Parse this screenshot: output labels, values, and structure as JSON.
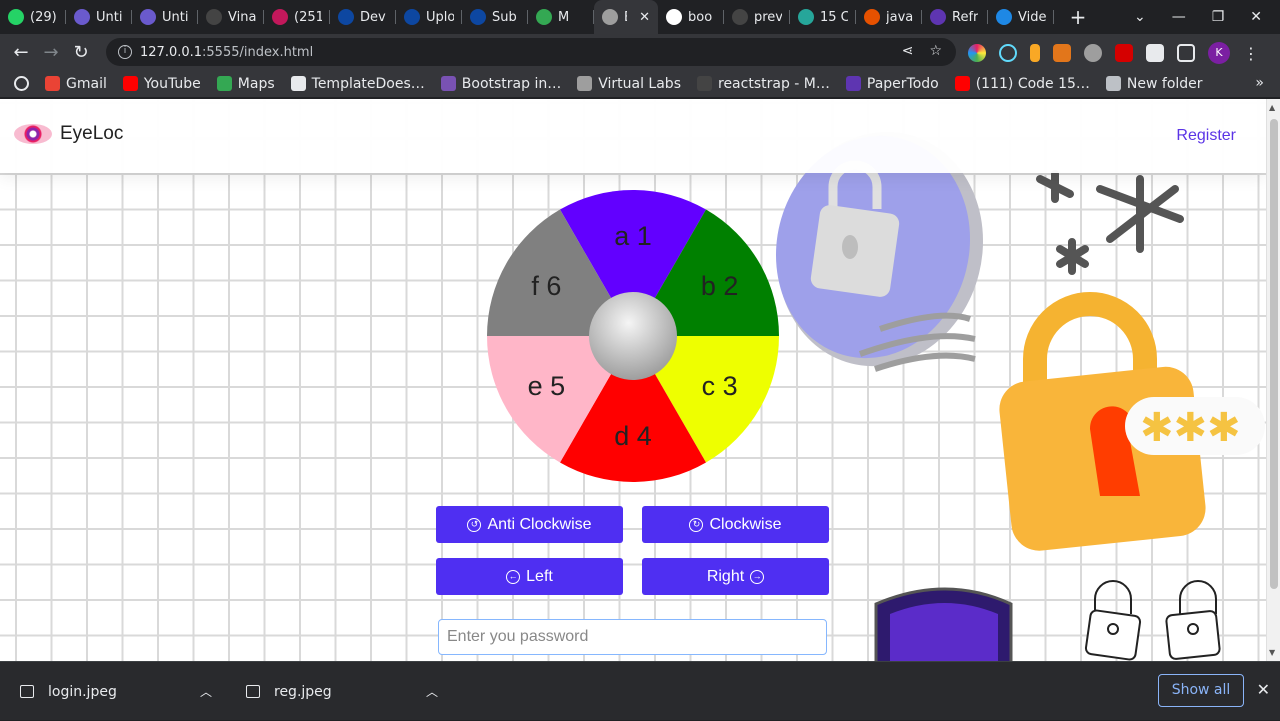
{
  "browser": {
    "tabs": [
      {
        "label": "(29)",
        "color": "#25d366"
      },
      {
        "label": "Unti",
        "color": "#6a5acd"
      },
      {
        "label": "Unti",
        "color": "#6a5acd"
      },
      {
        "label": "Vina",
        "color": "#444444"
      },
      {
        "label": "(251",
        "color": "#c2185b"
      },
      {
        "label": "Dev",
        "color": "#0d47a1"
      },
      {
        "label": "Uplo",
        "color": "#0d47a1"
      },
      {
        "label": "Sub",
        "color": "#0d47a1"
      },
      {
        "label": "M",
        "color": "#34a853"
      },
      {
        "label": "E",
        "color": "#9e9e9e",
        "active": true
      },
      {
        "label": "boo",
        "color": "#ffffff"
      },
      {
        "label": "prev",
        "color": "#444444"
      },
      {
        "label": "15 C",
        "color": "#26a69a"
      },
      {
        "label": "java",
        "color": "#e65100"
      },
      {
        "label": "Refr",
        "color": "#5e35b1"
      },
      {
        "label": "Vide",
        "color": "#1e88e5"
      }
    ],
    "active_tab_close": "✕",
    "new_tab": "+",
    "url_host": "127.0.0.1",
    "url_rest": ":5555/index.html",
    "profile_initial": "K",
    "bookmarks": [
      {
        "label": "Gmail",
        "color": "#ea4335"
      },
      {
        "label": "YouTube",
        "color": "#ff0000"
      },
      {
        "label": "Maps",
        "color": "#34a853"
      },
      {
        "label": "TemplateDoes…",
        "color": "#e8eaed"
      },
      {
        "label": "Bootstrap in…",
        "color": "#7952b3"
      },
      {
        "label": "Virtual Labs",
        "color": "#9e9e9e"
      },
      {
        "label": "reactstrap - M…",
        "color": "#444444"
      },
      {
        "label": "PaperTodo",
        "color": "#5e35b1"
      },
      {
        "label": "(111) Code 15…",
        "color": "#ff0000"
      },
      {
        "label": "New folder",
        "color": "#bdc1c6"
      }
    ],
    "bookmarks_more": "»"
  },
  "page": {
    "brand": "EyeLoc",
    "nav_register": "Register",
    "wheel": {
      "segments": [
        {
          "label": "a 1",
          "color": "#6200ff"
        },
        {
          "label": "b 2",
          "color": "#008000"
        },
        {
          "label": "c 3",
          "color": "#eeff00"
        },
        {
          "label": "d 4",
          "color": "#ff0000"
        },
        {
          "label": "e 5",
          "color": "#ffb6c8"
        },
        {
          "label": "f 6",
          "color": "#808080"
        }
      ]
    },
    "buttons": {
      "anticlockwise": "Anti Clockwise",
      "clockwise": "Clockwise",
      "left": "Left",
      "right": "Right"
    },
    "password_placeholder": "Enter you password",
    "accent": "#4f2ff2"
  },
  "downloads": {
    "items": [
      {
        "name": "login.jpeg"
      },
      {
        "name": "reg.jpeg"
      }
    ],
    "show_all": "Show all",
    "close": "✕"
  }
}
